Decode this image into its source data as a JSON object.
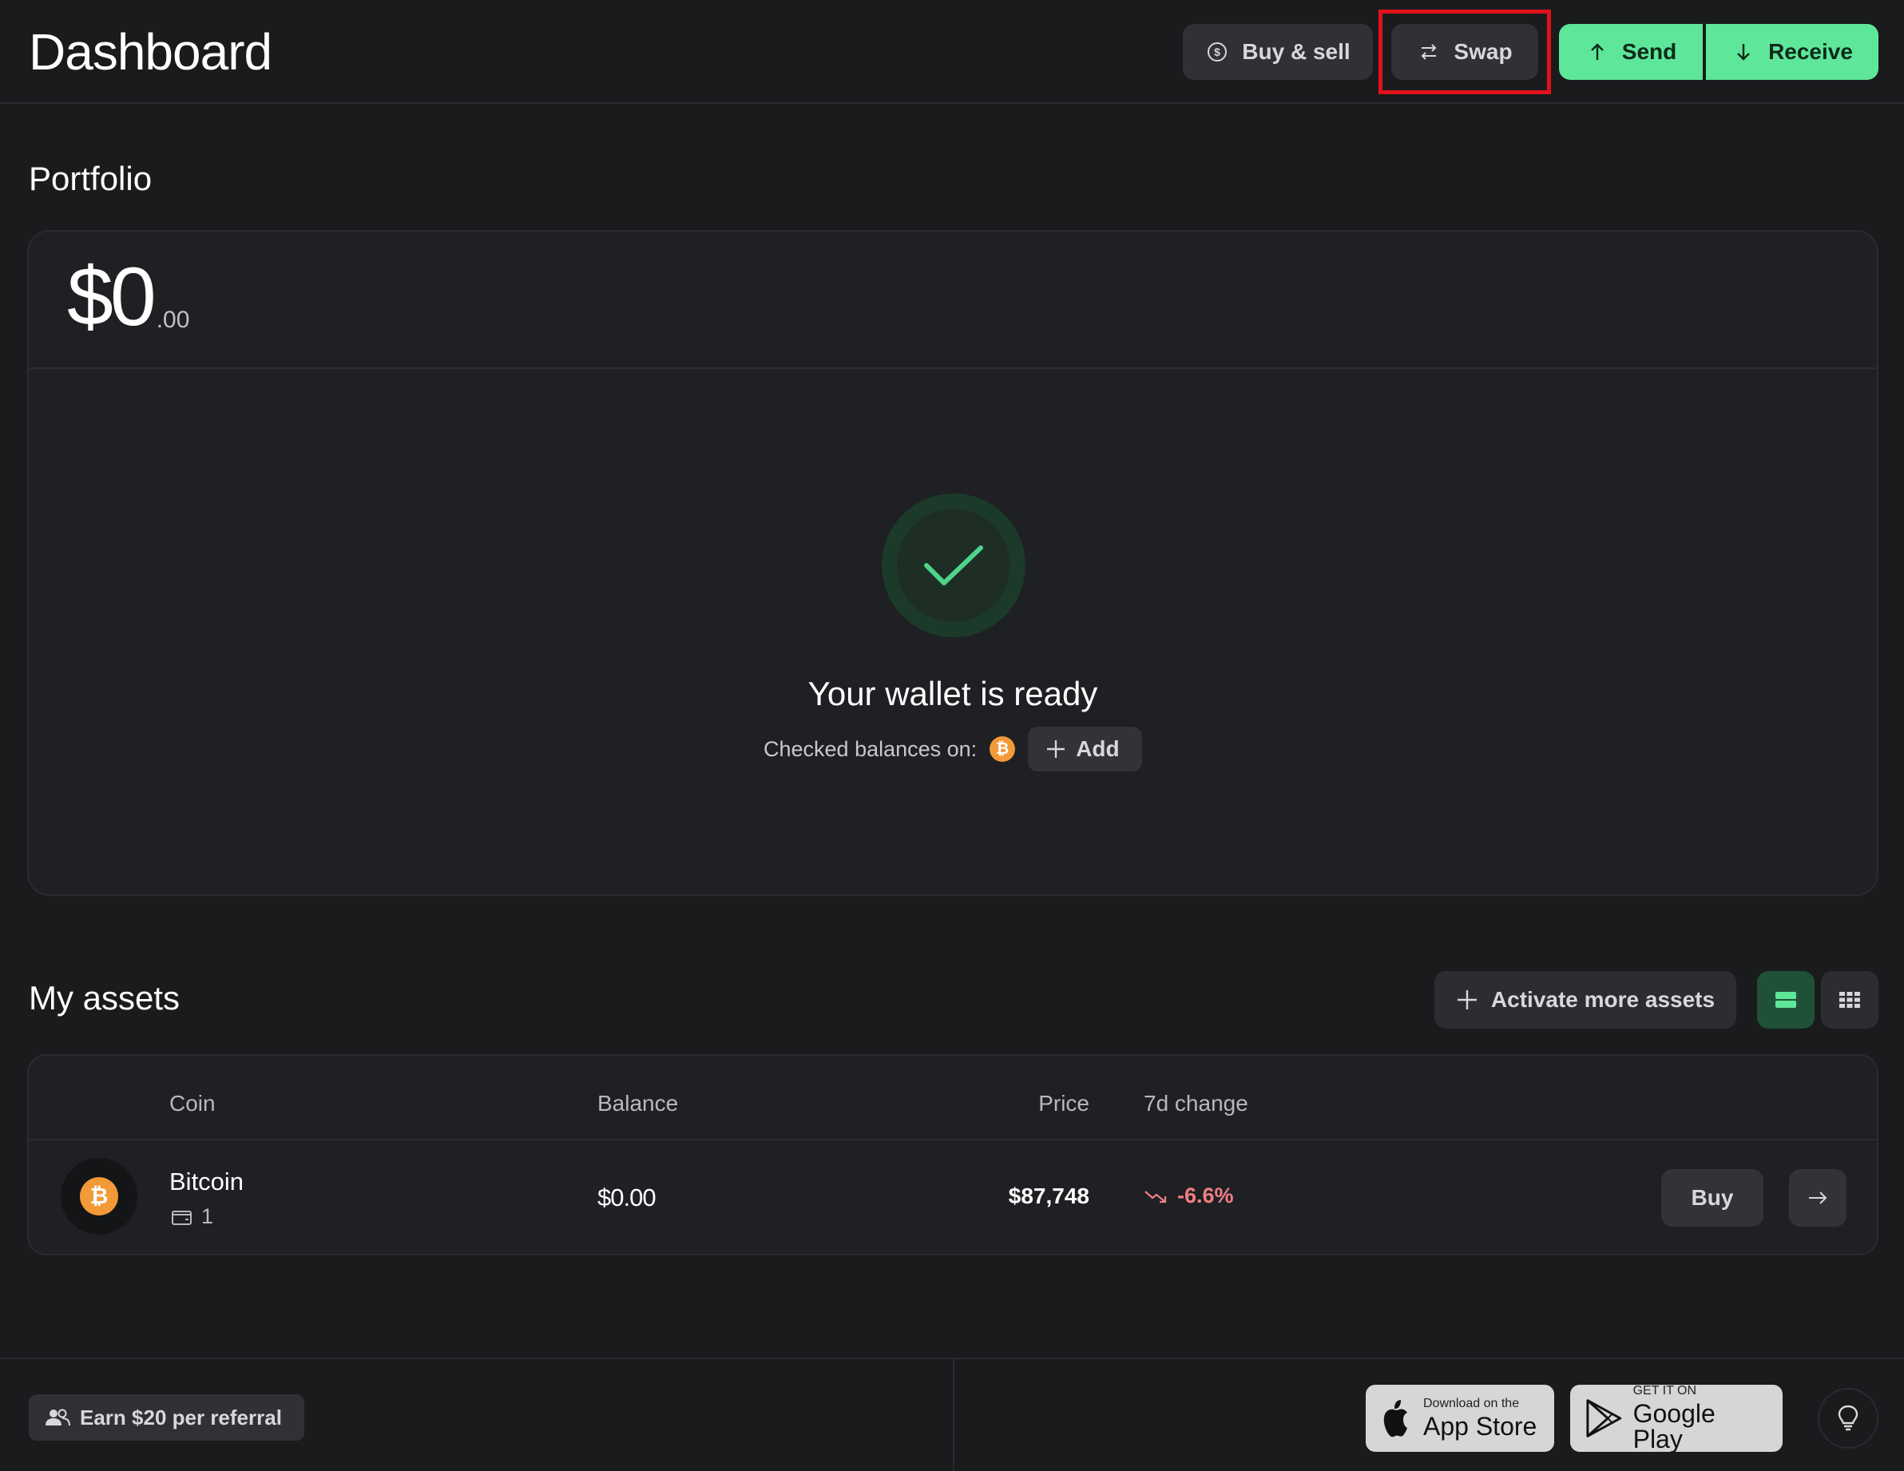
{
  "header": {
    "title": "Dashboard",
    "buy_sell_label": "Buy & sell",
    "swap_label": "Swap",
    "send_label": "Send",
    "receive_label": "Receive"
  },
  "portfolio": {
    "section_title": "Portfolio",
    "balance_main": "$0",
    "balance_cents": ".00",
    "status_title": "Your wallet is ready",
    "checked_label": "Checked balances on:",
    "checked_coin_symbol": "₿",
    "add_label": "Add"
  },
  "assets": {
    "section_title": "My assets",
    "activate_label": "Activate more assets",
    "columns": {
      "coin": "Coin",
      "balance": "Balance",
      "price": "Price",
      "change": "7d change"
    },
    "rows": [
      {
        "icon_symbol": "₿",
        "name": "Bitcoin",
        "wallet_count": "1",
        "balance": "$0.00",
        "price": "$87,748",
        "change": "-6.6%",
        "buy_label": "Buy"
      }
    ]
  },
  "footer": {
    "referral_label": "Earn $20 per referral",
    "app_store_small": "Download on the",
    "app_store_big": "App Store",
    "google_play_small": "GET IT ON",
    "google_play_big": "Google Play"
  },
  "colors": {
    "background": "#1a1b1d",
    "card": "#1f2023",
    "accent_green": "#5ee69a",
    "negative_red": "#f07f84",
    "bitcoin_orange": "#f29a38",
    "highlight_red": "#e0111a"
  }
}
